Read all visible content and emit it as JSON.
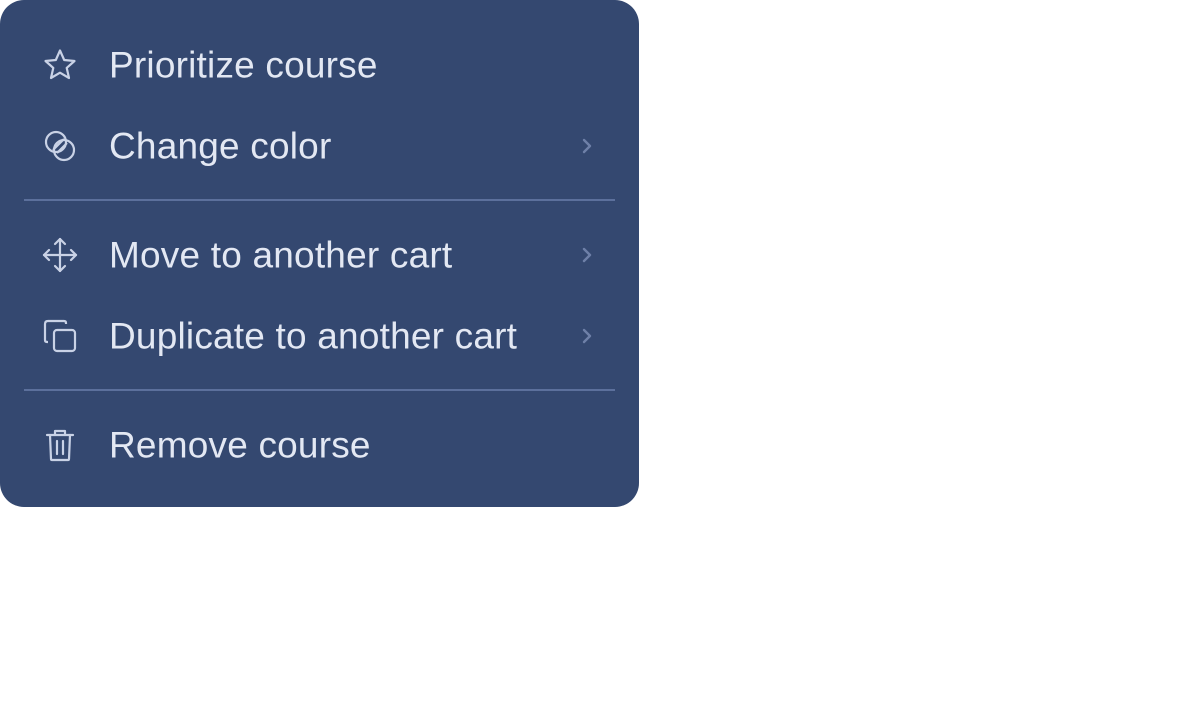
{
  "menu": {
    "items": [
      {
        "label": "Prioritize course",
        "icon": "star-icon",
        "has_submenu": false
      },
      {
        "label": "Change color",
        "icon": "color-circles-icon",
        "has_submenu": true
      },
      {
        "label": "Move to another cart",
        "icon": "move-arrows-icon",
        "has_submenu": true
      },
      {
        "label": "Duplicate to another cart",
        "icon": "duplicate-icon",
        "has_submenu": true
      },
      {
        "label": "Remove course",
        "icon": "trash-icon",
        "has_submenu": false
      }
    ]
  },
  "colors": {
    "menu_background": "#344870",
    "text": "#e3e8f3",
    "icon": "#c9d2e6",
    "chevron": "#6e80a8",
    "divider": "#5c709c",
    "page_background": "#ffffff"
  }
}
